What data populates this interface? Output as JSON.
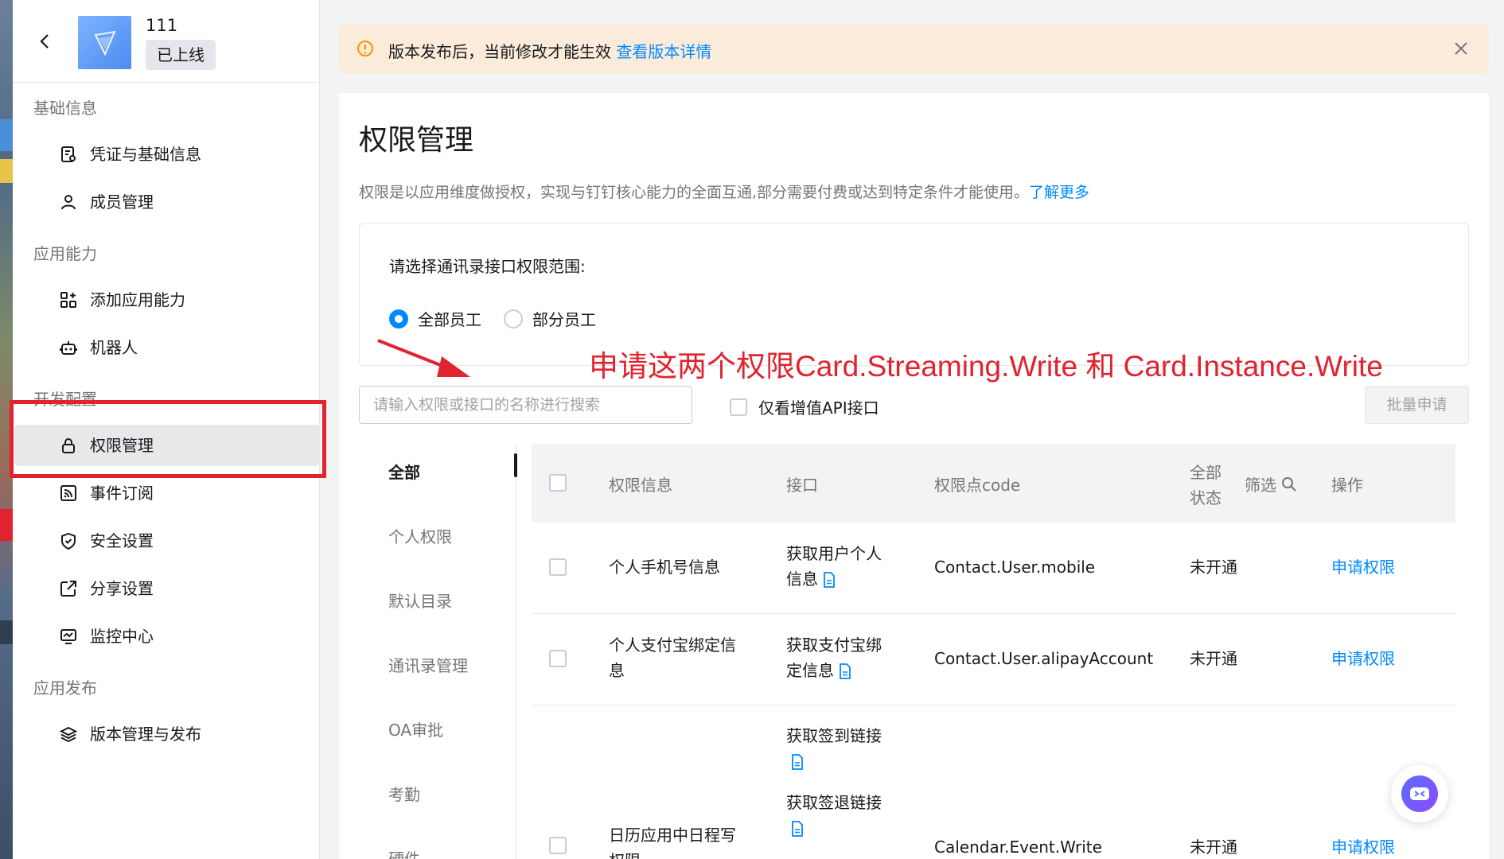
{
  "app": {
    "name": "111",
    "status": "已上线"
  },
  "notice": {
    "text": "版本发布后，当前修改才能生效",
    "link": "查看版本详情"
  },
  "sidebar": {
    "groups": [
      {
        "label": "基础信息"
      },
      {
        "label": "应用能力"
      },
      {
        "label": "开发配置"
      },
      {
        "label": "应用发布"
      }
    ],
    "items": [
      {
        "label": "凭证与基础信息",
        "icon": "credential-icon"
      },
      {
        "label": "成员管理",
        "icon": "user-icon"
      },
      {
        "label": "添加应用能力",
        "icon": "add-capability-icon"
      },
      {
        "label": "机器人",
        "icon": "robot-icon"
      },
      {
        "label": "权限管理",
        "icon": "lock-icon",
        "active": true
      },
      {
        "label": "事件订阅",
        "icon": "rss-icon"
      },
      {
        "label": "安全设置",
        "icon": "shield-icon"
      },
      {
        "label": "分享设置",
        "icon": "share-icon"
      },
      {
        "label": "监控中心",
        "icon": "monitor-icon"
      },
      {
        "label": "版本管理与发布",
        "icon": "layers-icon"
      }
    ]
  },
  "page": {
    "title": "权限管理",
    "description": "权限是以应用维度做授权，实现与钉钉核心能力的全面互通,部分需要付费或达到特定条件才能使用。",
    "learn_more": "了解更多"
  },
  "scope": {
    "title": "请选择通讯录接口权限范围:",
    "options": [
      {
        "label": "全部员工",
        "checked": true
      },
      {
        "label": "部分员工",
        "checked": false
      }
    ]
  },
  "annotation": "申请这两个权限Card.Streaming.Write 和 Card.Instance.Write",
  "search": {
    "placeholder": "请输入权限或接口的名称进行搜索",
    "value": ""
  },
  "value_added_only": {
    "label": "仅看增值API接口",
    "checked": false
  },
  "batch_button": "批量申请",
  "categories": [
    "全部",
    "个人权限",
    "默认目录",
    "通讯录管理",
    "OA审批",
    "考勤",
    "硬件"
  ],
  "active_category": "全部",
  "table": {
    "headers": {
      "info": "权限信息",
      "api": "接口",
      "code": "权限点code",
      "status_line1": "全部",
      "status_line2": "状态",
      "filter": "筛选",
      "action": "操作"
    },
    "rows": [
      {
        "info_line1": "个人手机号信息",
        "info_line2": "",
        "apis": [
          {
            "line1": "获取用户个人",
            "line2": "信息"
          }
        ],
        "code": "Contact.User.mobile",
        "status": "未开通",
        "action": "申请权限"
      },
      {
        "info_line1": "个人支付宝绑定信",
        "info_line2": "息",
        "apis": [
          {
            "line1": "获取支付宝绑",
            "line2": "定信息"
          }
        ],
        "code": "Contact.User.alipayAccount",
        "status": "未开通",
        "action": "申请权限"
      },
      {
        "info_line1": "日历应用中日程写",
        "info_line2": "权限",
        "apis": [
          {
            "line1": "获取签到链接",
            "line2": ""
          },
          {
            "line1": "获取签退链接",
            "line2": ""
          }
        ],
        "code": "Calendar.Event.Write",
        "status": "未开通",
        "action": "申请权限"
      }
    ]
  },
  "colors": {
    "accent": "#0089ff",
    "annotation": "#e0232e",
    "notice_bg": "#fbebda"
  }
}
